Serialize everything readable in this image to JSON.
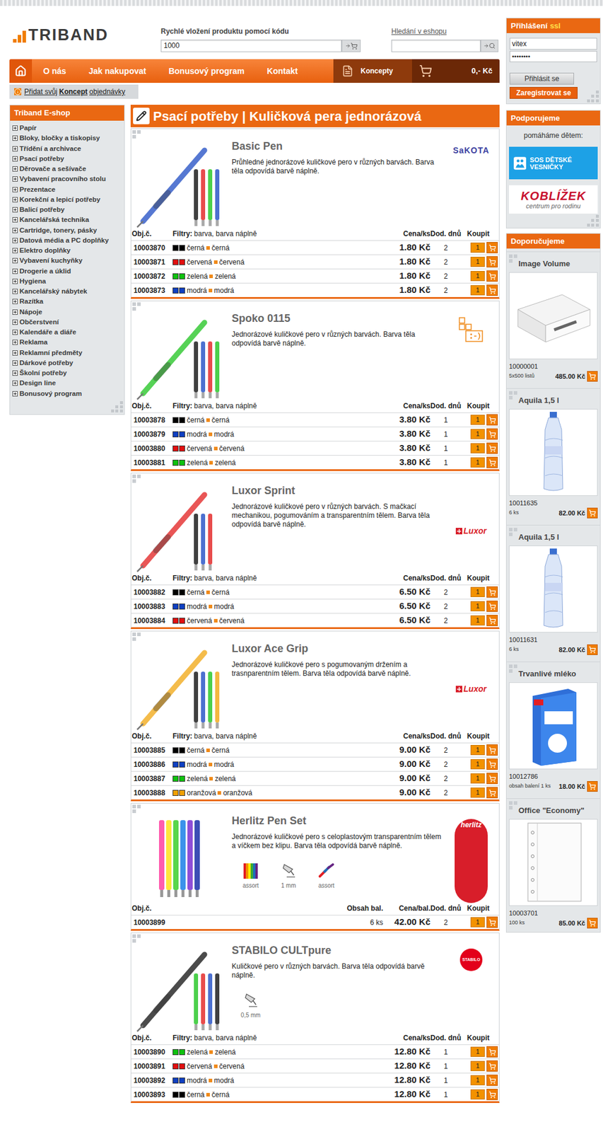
{
  "header": {
    "logo": "TRIBAND",
    "quick_add": {
      "label": "Rychlé vložení produktu pomocí kódu",
      "value": "1000"
    },
    "search": {
      "label": "Hledání v eshopu",
      "value": ""
    }
  },
  "login": {
    "title": "Přihlášení",
    "badge": "ssl",
    "username": "vitex",
    "password": "••••••••",
    "login_button": "Přihlásit se",
    "register_button": "Zaregistrovat se"
  },
  "nav": {
    "items": [
      "O nás",
      "Jak nakupovat",
      "Bonusový program",
      "Kontakt"
    ],
    "concepts": "Koncepty",
    "cart_total": "0,- Kč"
  },
  "concept_bar": {
    "prefix": "Přidat svůj",
    "bold": "Koncept",
    "suffix": "objednávky"
  },
  "sidebar": {
    "title": "Triband E-shop",
    "items": [
      {
        "label": "Papír",
        "expanded": false
      },
      {
        "label": "Bloky, bločky a tiskopisy",
        "expanded": false
      },
      {
        "label": "Třídění a archivace",
        "expanded": false
      },
      {
        "label": "Psací potřeby",
        "expanded": false
      },
      {
        "label": "Děrovače a sešívače",
        "expanded": false
      },
      {
        "label": "Vybavení pracovního stolu",
        "expanded": false
      },
      {
        "label": "Prezentace",
        "expanded": false
      },
      {
        "label": "Korekční a lepicí potřeby",
        "expanded": false
      },
      {
        "label": "Balicí potřeby",
        "expanded": false
      },
      {
        "label": "Kancelářská technika",
        "expanded": false
      },
      {
        "label": "Cartridge, tonery, pásky",
        "expanded": false
      },
      {
        "label": "Datová média a PC doplňky",
        "expanded": false
      },
      {
        "label": "Elektro doplňky",
        "expanded": false
      },
      {
        "label": "Vybavení kuchyňky",
        "expanded": false
      },
      {
        "label": "Drogerie a úklid",
        "expanded": false
      },
      {
        "label": "Hygiena",
        "expanded": false
      },
      {
        "label": "Kancelářský nábytek",
        "expanded": false
      },
      {
        "label": "Razítka",
        "expanded": false
      },
      {
        "label": "Nápoje",
        "expanded": false
      },
      {
        "label": "Občerstvení",
        "expanded": false
      },
      {
        "label": "Kalendáře a diáře",
        "expanded": false
      },
      {
        "label": "Reklama",
        "expanded": false
      },
      {
        "label": "Reklamní předměty",
        "expanded": false
      },
      {
        "label": "Dárkové potřeby",
        "expanded": false
      },
      {
        "label": "Školní potřeby",
        "expanded": false
      },
      {
        "label": "Design line",
        "expanded": false
      },
      {
        "label": "Bonusový program",
        "expanded": false
      }
    ]
  },
  "page_title": "Psací potřeby | Kuličková pera jednorázová",
  "products": [
    {
      "name": "Basic Pen",
      "description": "Průhledné jednorázové kuličkové pero v různých barvách. Barva těla odpovídá barvě náplně.",
      "brand": {
        "label": "SaKOTA",
        "kind": "sakota"
      },
      "photo": "pen",
      "features": [],
      "table": {
        "kind": "variants",
        "columns": {
          "code": "Obj.č.",
          "filter_label": "Filtry:",
          "filter_value": "barva, barva náplně",
          "price": "Cena/ks",
          "days": "Dod. dnů",
          "buy": "Koupit"
        },
        "rows": [
          {
            "code": "10003870",
            "color": "#000000",
            "body": "černá",
            "refill": "černá",
            "price": "1.80 Kč",
            "days": "2",
            "qty": "1"
          },
          {
            "code": "10003871",
            "color": "#e01010",
            "body": "červená",
            "refill": "červená",
            "price": "1.80 Kč",
            "days": "2",
            "qty": "1"
          },
          {
            "code": "10003872",
            "color": "#10c010",
            "body": "zelená",
            "refill": "zelená",
            "price": "1.80 Kč",
            "days": "2",
            "qty": "1"
          },
          {
            "code": "10003873",
            "color": "#1040c0",
            "body": "modrá",
            "refill": "modrá",
            "price": "1.80 Kč",
            "days": "2",
            "qty": "1"
          }
        ]
      }
    },
    {
      "name": "Spoko 0115",
      "description": "Jednorázové kuličkové pero v různých barvách. Barva těla odpovídá barvě náplně.",
      "brand": {
        "kind": "spoko"
      },
      "photo": "pen",
      "features": [],
      "table": {
        "kind": "variants",
        "columns": {
          "code": "Obj.č.",
          "filter_label": "Filtry:",
          "filter_value": "barva, barva náplně",
          "price": "Cena/ks",
          "days": "Dod. dnů",
          "buy": "Koupit"
        },
        "rows": [
          {
            "code": "10003878",
            "color": "#000000",
            "body": "černá",
            "refill": "černá",
            "price": "3.80 Kč",
            "days": "1",
            "qty": "1"
          },
          {
            "code": "10003879",
            "color": "#1040c0",
            "body": "modrá",
            "refill": "modrá",
            "price": "3.80 Kč",
            "days": "1",
            "qty": "1"
          },
          {
            "code": "10003880",
            "color": "#e01010",
            "body": "červená",
            "refill": "červená",
            "price": "3.80 Kč",
            "days": "1",
            "qty": "1"
          },
          {
            "code": "10003881",
            "color": "#10c010",
            "body": "zelená",
            "refill": "zelená",
            "price": "3.80 Kč",
            "days": "1",
            "qty": "1"
          }
        ]
      }
    },
    {
      "name": "Luxor Sprint",
      "description": "Jednorázové kuličkové pero v různých barvách. S mačkací mechanikou, pogumováním a transparentním tělem. Barva těla odpovídá barvě náplně.",
      "brand": {
        "label": "Luxor",
        "kind": "luxor"
      },
      "photo": "pen",
      "features": [],
      "table": {
        "kind": "variants",
        "columns": {
          "code": "Obj.č.",
          "filter_label": "Filtry:",
          "filter_value": "barva, barva náplně",
          "price": "Cena/ks",
          "days": "Dod. dnů",
          "buy": "Koupit"
        },
        "rows": [
          {
            "code": "10003882",
            "color": "#000000",
            "body": "černá",
            "refill": "černá",
            "price": "6.50 Kč",
            "days": "2",
            "qty": "1"
          },
          {
            "code": "10003883",
            "color": "#1040c0",
            "body": "modrá",
            "refill": "modrá",
            "price": "6.50 Kč",
            "days": "2",
            "qty": "1"
          },
          {
            "code": "10003884",
            "color": "#e01010",
            "body": "červená",
            "refill": "červená",
            "price": "6.50 Kč",
            "days": "2",
            "qty": "1"
          }
        ]
      }
    },
    {
      "name": "Luxor Ace Grip",
      "description": "Jednorázové kuličkové pero s pogumovaným držením a trasnparentním tělem. Barva těla odpovídá barvě náplně.",
      "brand": {
        "label": "Luxor",
        "kind": "luxor"
      },
      "photo": "pen",
      "features": [],
      "table": {
        "kind": "variants",
        "columns": {
          "code": "Obj.č.",
          "filter_label": "Filtry:",
          "filter_value": "barva, barva náplně",
          "price": "Cena/ks",
          "days": "Dod. dnů",
          "buy": "Koupit"
        },
        "rows": [
          {
            "code": "10003885",
            "color": "#000000",
            "body": "černá",
            "refill": "černá",
            "price": "9.00 Kč",
            "days": "2",
            "qty": "1"
          },
          {
            "code": "10003886",
            "color": "#1040c0",
            "body": "modrá",
            "refill": "modrá",
            "price": "9.00 Kč",
            "days": "2",
            "qty": "1"
          },
          {
            "code": "10003887",
            "color": "#10c010",
            "body": "zelená",
            "refill": "zelená",
            "price": "9.00 Kč",
            "days": "2",
            "qty": "1"
          },
          {
            "code": "10003888",
            "color": "#f0a000",
            "body": "oranžová",
            "refill": "oranžová",
            "price": "9.00 Kč",
            "days": "2",
            "qty": "1"
          }
        ]
      }
    },
    {
      "name": "Herlitz Pen Set",
      "description": "Jednorázové kuličkové pero s celoplastovým transparentním tělem a víčkem bez klipu. Barva těla odpovídá barvě náplně.",
      "brand": {
        "label": "herlitz",
        "kind": "herlitz"
      },
      "photo": "pen-set",
      "features": [
        {
          "label": "assort",
          "kind": "assort"
        },
        {
          "label": "1 mm",
          "kind": "tip"
        },
        {
          "label": "assort",
          "kind": "ink"
        }
      ],
      "table": {
        "kind": "pack",
        "columns": {
          "code": "Obj.č.",
          "content": "Obsah bal.",
          "price": "Cena/bal.",
          "days": "Dod. dnů",
          "buy": "Koupit"
        },
        "rows": [
          {
            "code": "10003899",
            "content": "6 ks",
            "price": "42.00 Kč",
            "days": "2",
            "qty": "1"
          }
        ]
      }
    },
    {
      "name": "STABILO CULTpure",
      "description": "Kuličkové pero v různých barvách. Barva těla odpovídá barvě náplně.",
      "brand": {
        "label": "STABILO",
        "kind": "stabilo"
      },
      "photo": "pen",
      "features": [
        {
          "label": "0,5 mm",
          "kind": "tip"
        }
      ],
      "table": {
        "kind": "variants",
        "columns": {
          "code": "Obj.č.",
          "filter_label": "Filtry:",
          "filter_value": "barva, barva náplně",
          "price": "Cena/ks",
          "days": "Dod. dnů",
          "buy": "Koupit"
        },
        "rows": [
          {
            "code": "10003890",
            "color": "#10c010",
            "body": "zelená",
            "refill": "zelená",
            "price": "12.80 Kč",
            "days": "1",
            "qty": "1"
          },
          {
            "code": "10003891",
            "color": "#e01010",
            "body": "červená",
            "refill": "červená",
            "price": "12.80 Kč",
            "days": "1",
            "qty": "1"
          },
          {
            "code": "10003892",
            "color": "#1040c0",
            "body": "modrá",
            "refill": "modrá",
            "price": "12.80 Kč",
            "days": "1",
            "qty": "1"
          },
          {
            "code": "10003893",
            "color": "#000000",
            "body": "černá",
            "refill": "černá",
            "price": "12.80 Kč",
            "days": "1",
            "qty": "1"
          }
        ]
      }
    }
  ],
  "support": {
    "title": "Podporujeme",
    "subtitle": "pomáháme dětem:",
    "partners": [
      {
        "kind": "sos",
        "label": "SOS DĚTSKÉ VESNIČKY"
      },
      {
        "kind": "koblizek",
        "label": "KOBLÍŽEK",
        "sublabel": "centrum pro rodinu"
      }
    ]
  },
  "recommended": {
    "title": "Doporučujeme",
    "items": [
      {
        "name": "Image Volume",
        "code": "10000001",
        "unit": "5x500 listů",
        "price": "485.00 Kč",
        "kind": "paper-box"
      },
      {
        "name": "Aquila 1,5 l",
        "code": "10011635",
        "unit": "6 ks",
        "price": "82.00 Kč",
        "kind": "bottle"
      },
      {
        "name": "Aquila 1,5 l",
        "code": "10011631",
        "unit": "6 ks",
        "price": "82.00 Kč",
        "kind": "bottle"
      },
      {
        "name": "Trvanlivé mléko",
        "code": "10012786",
        "unit": "obsah balení 1 ks",
        "price": "18.00 Kč",
        "kind": "milk-carton"
      },
      {
        "name": "Office \"Economy\"",
        "code": "10003701",
        "unit": "100 ks",
        "price": "85.00 Kč",
        "kind": "sheet-protector"
      }
    ]
  }
}
